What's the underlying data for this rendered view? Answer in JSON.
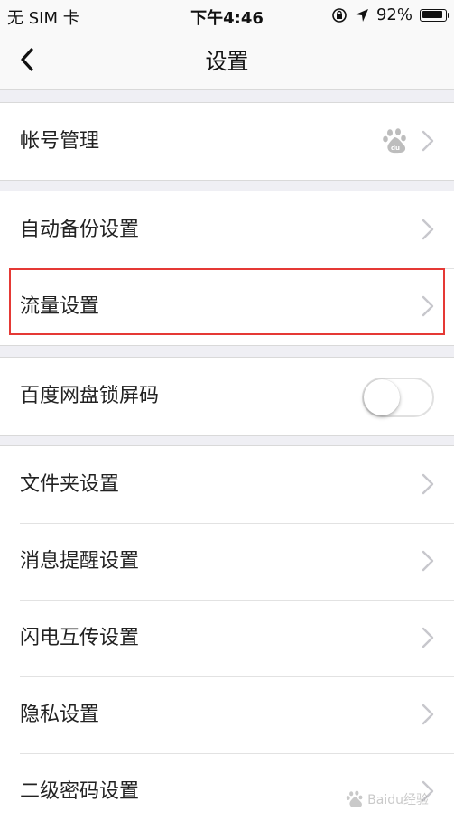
{
  "status_bar": {
    "carrier": "无 SIM 卡",
    "time": "下午4:46",
    "battery": "92%",
    "battery_level": 0.92
  },
  "nav": {
    "title": "设置",
    "back_icon": "chevron-left-icon"
  },
  "groups": [
    {
      "rows": [
        {
          "label": "帐号管理",
          "accessory": "baidu-paw-icon",
          "chevron": true
        }
      ]
    },
    {
      "rows": [
        {
          "label": "自动备份设置",
          "chevron": true
        },
        {
          "label": "流量设置",
          "chevron": true,
          "highlighted": true
        }
      ]
    },
    {
      "rows": [
        {
          "label": "百度网盘锁屏码",
          "toggle": "off"
        }
      ]
    },
    {
      "rows": [
        {
          "label": "文件夹设置",
          "chevron": true
        },
        {
          "label": "消息提醒设置",
          "chevron": true
        },
        {
          "label": "闪电互传设置",
          "chevron": true
        },
        {
          "label": "隐私设置",
          "chevron": true
        },
        {
          "label": "二级密码设置",
          "chevron": true
        }
      ]
    }
  ],
  "colors": {
    "background": "#efeff4",
    "highlight": "#e53935",
    "chevron": "#c7c7cc"
  },
  "watermark": "Baidu经验"
}
